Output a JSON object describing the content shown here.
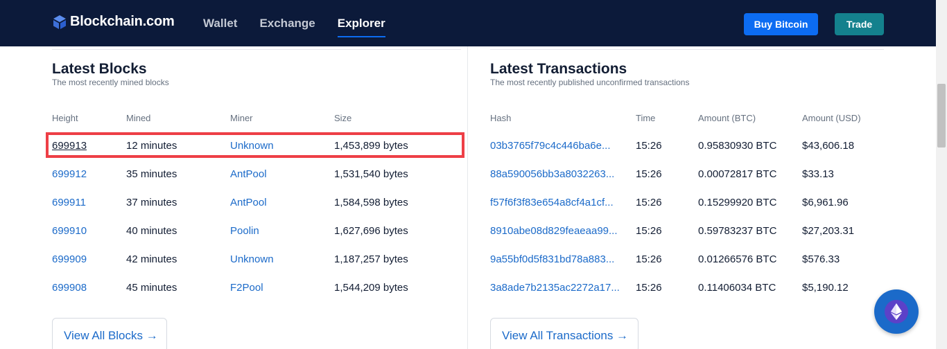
{
  "header": {
    "logo_text": "Blockchain.com",
    "nav": [
      "Wallet",
      "Exchange",
      "Explorer"
    ],
    "buy_label": "Buy Bitcoin",
    "trade_label": "Trade"
  },
  "blocks": {
    "title": "Latest Blocks",
    "subtitle": "The most recently mined blocks",
    "columns": [
      "Height",
      "Mined",
      "Miner",
      "Size"
    ],
    "rows": [
      [
        "699913",
        "12 minutes",
        "Unknown",
        "1,453,899 bytes"
      ],
      [
        "699912",
        "35 minutes",
        "AntPool",
        "1,531,540 bytes"
      ],
      [
        "699911",
        "37 minutes",
        "AntPool",
        "1,584,598 bytes"
      ],
      [
        "699910",
        "40 minutes",
        "Poolin",
        "1,627,696 bytes"
      ],
      [
        "699909",
        "42 minutes",
        "Unknown",
        "1,187,257 bytes"
      ],
      [
        "699908",
        "45 minutes",
        "F2Pool",
        "1,544,209 bytes"
      ]
    ],
    "view_all": "View All Blocks →"
  },
  "transactions": {
    "title": "Latest Transactions",
    "subtitle": "The most recently published unconfirmed transactions",
    "columns": [
      "Hash",
      "Time",
      "Amount (BTC)",
      "Amount (USD)"
    ],
    "rows": [
      [
        "03b3765f79c4c446ba6e...",
        "15:26",
        "0.95830930 BTC",
        "$43,606.18"
      ],
      [
        "88a590056bb3a8032263...",
        "15:26",
        "0.00072817 BTC",
        "$33.13"
      ],
      [
        "f57f6f3f83e654a8cf4a1cf...",
        "15:26",
        "0.15299920 BTC",
        "$6,961.96"
      ],
      [
        "8910abe08d829feaeaa99...",
        "15:26",
        "0.59783237 BTC",
        "$27,203.31"
      ],
      [
        "9a55bf0d5f831bd78a883...",
        "15:26",
        "0.01266576 BTC",
        "$576.33"
      ],
      [
        "3a8ade7b2135ac2272a17...",
        "15:26",
        "0.11406034 BTC",
        "$5,190.12"
      ]
    ],
    "view_all": "View All Transactions →"
  },
  "colors": {
    "header_bg": "#0c1a3a",
    "link": "#1b6ac9",
    "buy_button": "#0c6cf2",
    "trade_button": "#14818d",
    "highlight": "#ee3f46"
  }
}
